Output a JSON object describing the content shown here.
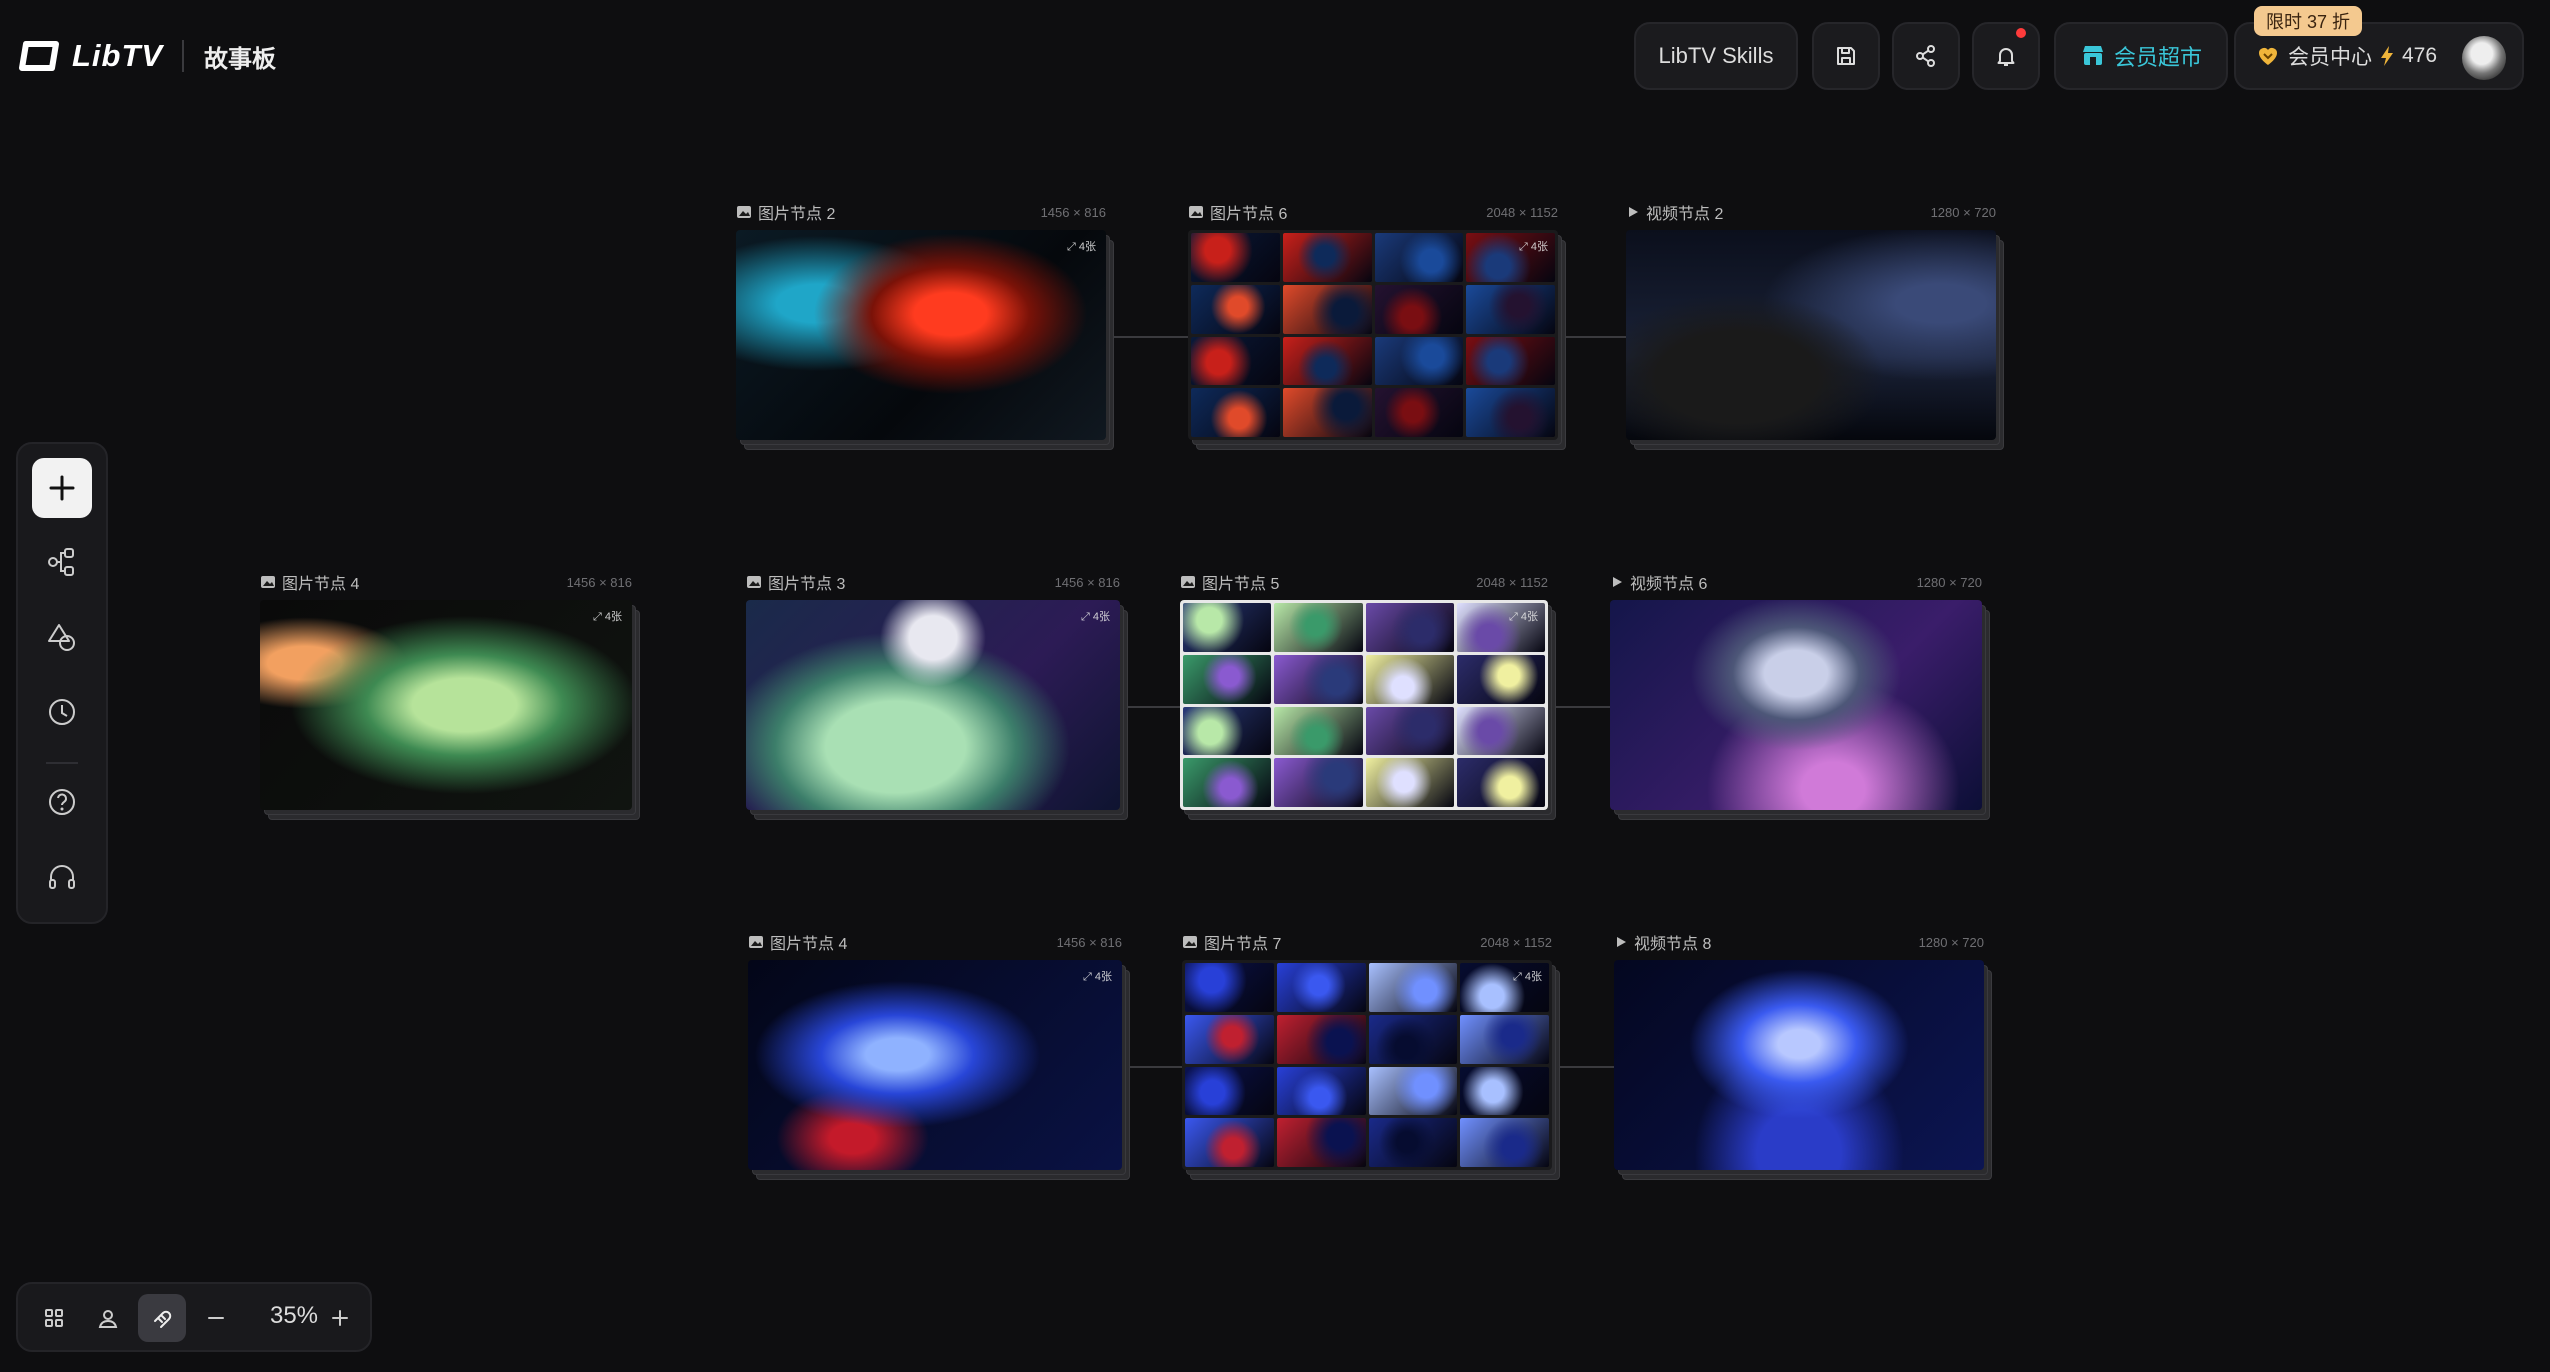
{
  "app": {
    "logo_text": "LibTV",
    "board_title": "故事板"
  },
  "header": {
    "skills_label": "LibTV Skills",
    "market_label": "会员超市",
    "promo_badge": "限时 37 折",
    "member_label": "会员中心",
    "credits": "476",
    "accent_color": "#3ac6d8"
  },
  "left_toolbar": {
    "items": [
      "add",
      "workflow",
      "assets",
      "history",
      "help",
      "support"
    ]
  },
  "bottom_toolbar": {
    "zoom": "35%",
    "zoom_out_icon": "minus-icon",
    "zoom_in_icon": "plus-icon"
  },
  "nodes": [
    {
      "id": "n2",
      "type": "image",
      "title": "图片节点 2",
      "dim": "1456 × 816",
      "tone": "car-red"
    },
    {
      "id": "n6",
      "type": "image",
      "title": "图片节点 6",
      "dim": "2048 × 1152",
      "tone": "grid-red"
    },
    {
      "id": "v2",
      "type": "video",
      "title": "视频节点 2",
      "dim": "1280 × 720",
      "tone": "car-dark"
    },
    {
      "id": "n4a",
      "type": "image",
      "title": "图片节点 4",
      "dim": "1456 × 816",
      "tone": "face-green"
    },
    {
      "id": "n3",
      "type": "image",
      "title": "图片节点 3",
      "dim": "1456 × 816",
      "tone": "robot-green"
    },
    {
      "id": "n5",
      "type": "image",
      "title": "图片节点 5",
      "dim": "2048 × 1152",
      "tone": "grid-green"
    },
    {
      "id": "v6",
      "type": "video",
      "title": "视频节点 6",
      "dim": "1280 × 720",
      "tone": "robot-purple"
    },
    {
      "id": "n4b",
      "type": "image",
      "title": "图片节点 4",
      "dim": "1456 × 816",
      "tone": "girl-blue"
    },
    {
      "id": "n7",
      "type": "image",
      "title": "图片节点 7",
      "dim": "2048 × 1152",
      "tone": "grid-blue"
    },
    {
      "id": "v8",
      "type": "video",
      "title": "视频节点 8",
      "dim": "1280 × 720",
      "tone": "girl-blue2"
    }
  ],
  "expand_label": "4张"
}
